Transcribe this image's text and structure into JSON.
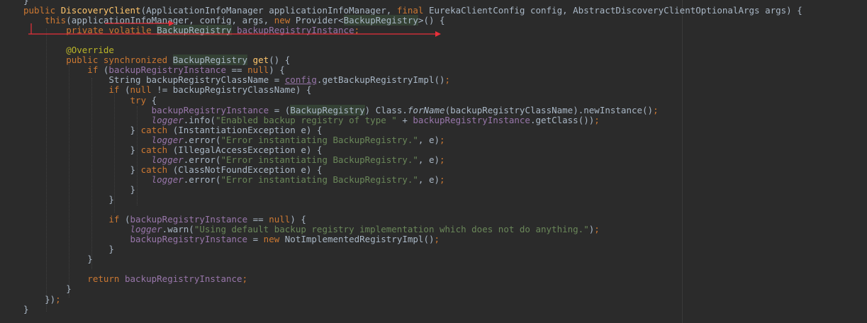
{
  "editor": {
    "lines": [
      {
        "segments": [
          {
            "t": "}",
            "c": ""
          }
        ]
      },
      {
        "segments": [
          {
            "t": "public ",
            "c": "kw"
          },
          {
            "t": "DiscoveryClient",
            "c": "fn"
          },
          {
            "t": "(ApplicationInfoManager applicationInfoManager, ",
            "c": ""
          },
          {
            "t": "final ",
            "c": "kw"
          },
          {
            "t": "EurekaClientConfig config, AbstractDiscoveryClientOptionalArgs args) {",
            "c": ""
          }
        ]
      },
      {
        "segments": [
          {
            "t": "    this",
            "c": "kw"
          },
          {
            "t": "(applicationInfoManager, config, args, ",
            "c": ""
          },
          {
            "t": "new ",
            "c": "kw"
          },
          {
            "t": "Provider<",
            "c": ""
          },
          {
            "t": "BackupRegistry",
            "c": "cls-hl"
          },
          {
            "t": ">() {",
            "c": ""
          }
        ]
      },
      {
        "segments": [
          {
            "t": "        private volatile ",
            "c": "kw"
          },
          {
            "t": "BackupRegistry",
            "c": "cls-hl"
          },
          {
            "t": " ",
            "c": ""
          },
          {
            "t": "backupRegistryInstance",
            "c": "field"
          },
          {
            "t": ";",
            "c": "kw"
          }
        ]
      },
      {
        "segments": [
          {
            "t": "",
            "c": ""
          }
        ]
      },
      {
        "segments": [
          {
            "t": "        @Override",
            "c": "ann"
          }
        ]
      },
      {
        "segments": [
          {
            "t": "        public synchronized ",
            "c": "kw"
          },
          {
            "t": "BackupRegistry",
            "c": "cls-hl"
          },
          {
            "t": " ",
            "c": ""
          },
          {
            "t": "get",
            "c": "fn"
          },
          {
            "t": "() {",
            "c": ""
          }
        ]
      },
      {
        "segments": [
          {
            "t": "            if ",
            "c": "kw"
          },
          {
            "t": "(",
            "c": ""
          },
          {
            "t": "backupRegistryInstance",
            "c": "field"
          },
          {
            "t": " == ",
            "c": ""
          },
          {
            "t": "null",
            "c": "kw"
          },
          {
            "t": ") {",
            "c": ""
          }
        ]
      },
      {
        "segments": [
          {
            "t": "                String backupRegistryClassName = ",
            "c": ""
          },
          {
            "t": "config",
            "c": "field under"
          },
          {
            "t": ".getBackupRegistryImpl()",
            "c": ""
          },
          {
            "t": ";",
            "c": "kw"
          }
        ]
      },
      {
        "segments": [
          {
            "t": "                if ",
            "c": "kw"
          },
          {
            "t": "(",
            "c": ""
          },
          {
            "t": "null ",
            "c": "kw"
          },
          {
            "t": "!= backupRegistryClassName) {",
            "c": ""
          }
        ]
      },
      {
        "segments": [
          {
            "t": "                    try ",
            "c": "kw"
          },
          {
            "t": "{",
            "c": ""
          }
        ]
      },
      {
        "segments": [
          {
            "t": "                        ",
            "c": ""
          },
          {
            "t": "backupRegistryInstance",
            "c": "field"
          },
          {
            "t": " = (",
            "c": ""
          },
          {
            "t": "BackupRegistry",
            "c": "cls-hl"
          },
          {
            "t": ") Class.",
            "c": ""
          },
          {
            "t": "forName",
            "c": "static"
          },
          {
            "t": "(backupRegistryClassName).newInstance()",
            "c": ""
          },
          {
            "t": ";",
            "c": "kw"
          }
        ]
      },
      {
        "segments": [
          {
            "t": "                        ",
            "c": ""
          },
          {
            "t": "logger",
            "c": "italicfield"
          },
          {
            "t": ".info(",
            "c": ""
          },
          {
            "t": "\"Enabled backup registry of type \"",
            "c": "str"
          },
          {
            "t": " + ",
            "c": ""
          },
          {
            "t": "backupRegistryInstance",
            "c": "field"
          },
          {
            "t": ".getClass())",
            "c": ""
          },
          {
            "t": ";",
            "c": "kw"
          }
        ]
      },
      {
        "segments": [
          {
            "t": "                    } ",
            "c": ""
          },
          {
            "t": "catch ",
            "c": "kw"
          },
          {
            "t": "(InstantiationException e) {",
            "c": ""
          }
        ]
      },
      {
        "segments": [
          {
            "t": "                        ",
            "c": ""
          },
          {
            "t": "logger",
            "c": "italicfield"
          },
          {
            "t": ".error(",
            "c": ""
          },
          {
            "t": "\"Error instantiating BackupRegistry.\"",
            "c": "str"
          },
          {
            "t": ", e)",
            "c": ""
          },
          {
            "t": ";",
            "c": "kw"
          }
        ]
      },
      {
        "segments": [
          {
            "t": "                    } ",
            "c": ""
          },
          {
            "t": "catch ",
            "c": "kw"
          },
          {
            "t": "(IllegalAccessException e) {",
            "c": ""
          }
        ]
      },
      {
        "segments": [
          {
            "t": "                        ",
            "c": ""
          },
          {
            "t": "logger",
            "c": "italicfield"
          },
          {
            "t": ".error(",
            "c": ""
          },
          {
            "t": "\"Error instantiating BackupRegistry.\"",
            "c": "str"
          },
          {
            "t": ", e)",
            "c": ""
          },
          {
            "t": ";",
            "c": "kw"
          }
        ]
      },
      {
        "segments": [
          {
            "t": "                    } ",
            "c": ""
          },
          {
            "t": "catch ",
            "c": "kw"
          },
          {
            "t": "(ClassNotFoundException e) {",
            "c": ""
          }
        ]
      },
      {
        "segments": [
          {
            "t": "                        ",
            "c": ""
          },
          {
            "t": "logger",
            "c": "italicfield"
          },
          {
            "t": ".error(",
            "c": ""
          },
          {
            "t": "\"Error instantiating BackupRegistry.\"",
            "c": "str"
          },
          {
            "t": ", e)",
            "c": ""
          },
          {
            "t": ";",
            "c": "kw"
          }
        ]
      },
      {
        "segments": [
          {
            "t": "                    }",
            "c": ""
          }
        ]
      },
      {
        "segments": [
          {
            "t": "                }",
            "c": ""
          }
        ]
      },
      {
        "segments": [
          {
            "t": "",
            "c": ""
          }
        ]
      },
      {
        "segments": [
          {
            "t": "                if ",
            "c": "kw"
          },
          {
            "t": "(",
            "c": ""
          },
          {
            "t": "backupRegistryInstance",
            "c": "field"
          },
          {
            "t": " == ",
            "c": ""
          },
          {
            "t": "null",
            "c": "kw"
          },
          {
            "t": ") {",
            "c": ""
          }
        ]
      },
      {
        "segments": [
          {
            "t": "                    ",
            "c": ""
          },
          {
            "t": "logger",
            "c": "italicfield"
          },
          {
            "t": ".warn(",
            "c": ""
          },
          {
            "t": "\"Using default backup registry implementation which does not do anything.\"",
            "c": "str"
          },
          {
            "t": ")",
            "c": ""
          },
          {
            "t": ";",
            "c": "kw"
          }
        ]
      },
      {
        "segments": [
          {
            "t": "                    ",
            "c": ""
          },
          {
            "t": "backupRegistryInstance",
            "c": "field"
          },
          {
            "t": " = ",
            "c": ""
          },
          {
            "t": "new ",
            "c": "kw"
          },
          {
            "t": "NotImplementedRegistryImpl()",
            "c": ""
          },
          {
            "t": ";",
            "c": "kw"
          }
        ]
      },
      {
        "segments": [
          {
            "t": "                }",
            "c": ""
          }
        ]
      },
      {
        "segments": [
          {
            "t": "            }",
            "c": ""
          }
        ]
      },
      {
        "segments": [
          {
            "t": "",
            "c": ""
          }
        ]
      },
      {
        "segments": [
          {
            "t": "            return ",
            "c": "kw"
          },
          {
            "t": "backupRegistryInstance",
            "c": "field"
          },
          {
            "t": ";",
            "c": "kw"
          }
        ]
      },
      {
        "segments": [
          {
            "t": "        }",
            "c": ""
          }
        ]
      },
      {
        "segments": [
          {
            "t": "    })",
            "c": ""
          },
          {
            "t": ";",
            "c": "kw"
          }
        ]
      },
      {
        "segments": [
          {
            "t": "}",
            "c": ""
          }
        ]
      }
    ]
  },
  "colors": {
    "background": "#2b2b2b",
    "keyword": "#cc7832",
    "method": "#ffc66d",
    "string": "#6a8759",
    "field": "#9876aa",
    "annotation": "#bbb529",
    "default": "#a9b7c6",
    "arrow": "#e8303a"
  }
}
